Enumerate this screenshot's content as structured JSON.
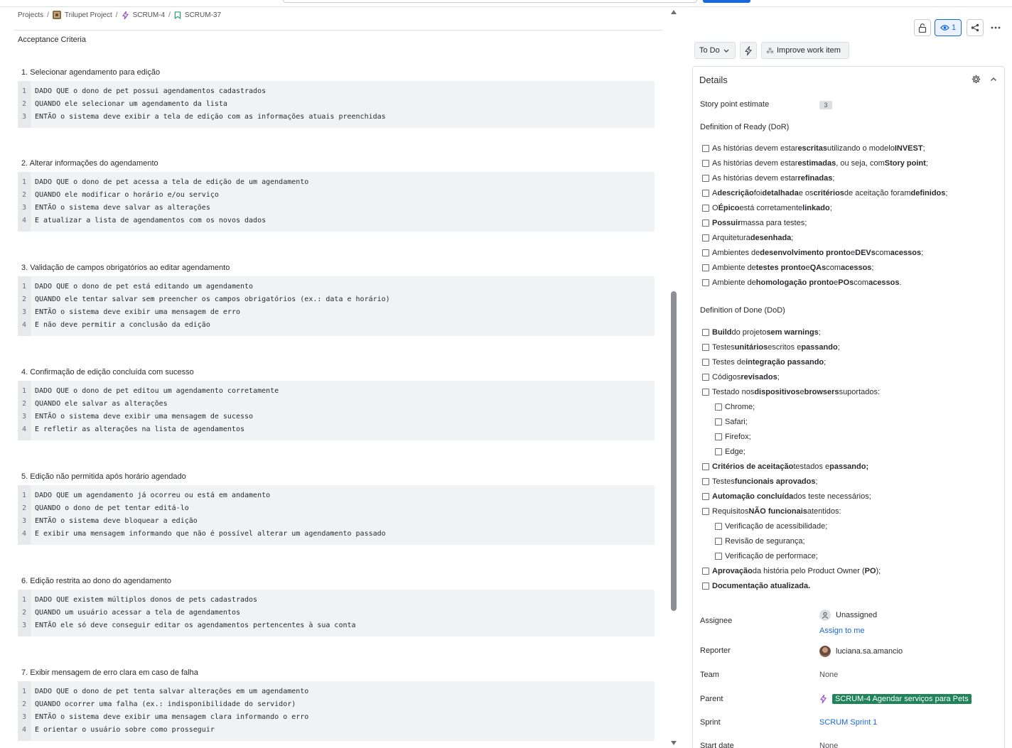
{
  "breadcrumb": {
    "items": [
      "Projects",
      "Trilupet Project",
      "SCRUM-4",
      "SCRUM-37"
    ],
    "separator": "/"
  },
  "main": {
    "section_title": "Acceptance Criteria",
    "criteria": [
      {
        "title": "1. Selecionar agendamento para edição",
        "lines": [
          "DADO QUE o dono de pet possui agendamentos cadastrados",
          "QUANDO ele selecionar um agendamento da lista",
          "ENTÃO o sistema deve exibir a tela de edição com as informações atuais preenchidas"
        ]
      },
      {
        "title": "2. Alterar informações do agendamento",
        "lines": [
          "DADO QUE o dono de pet acessa a tela de edição de um agendamento",
          "QUANDO ele modificar o horário e/ou serviço",
          "ENTÃO o sistema deve salvar as alterações",
          "E atualizar a lista de agendamentos com os novos dados"
        ]
      },
      {
        "title": "3. Validação de campos obrigatórios ao editar agendamento",
        "lines": [
          "DADO QUE o dono de pet está editando um agendamento",
          "QUANDO ele tentar salvar sem preencher os campos obrigatórios (ex.: data e horário)",
          "ENTÃO o sistema deve exibir uma mensagem de erro",
          "E não deve permitir a conclusão da edição"
        ]
      },
      {
        "title": "4. Confirmação de edição concluída com sucesso",
        "lines": [
          "DADO QUE o dono de pet editou um agendamento corretamente",
          "QUANDO ele salvar as alterações",
          "ENTÃO o sistema deve exibir uma mensagem de sucesso",
          "E refletir as alterações na lista de agendamentos"
        ]
      },
      {
        "title": "5. Edição não permitida após horário agendado",
        "lines": [
          "DADO QUE um agendamento já ocorreu ou está em andamento",
          "QUANDO o dono de pet tentar editá-lo",
          "ENTÃO o sistema deve bloquear a edição",
          "E exibir uma mensagem informando que não é possível alterar um agendamento passado"
        ]
      },
      {
        "title": "6. Edição restrita ao dono do agendamento",
        "lines": [
          "DADO QUE existem múltiplos donos de pets cadastrados",
          "QUANDO um usuário acessar a tela de agendamentos",
          "ENTÃO ele só deve conseguir editar os agendamentos pertencentes à sua conta"
        ]
      },
      {
        "title": "7. Exibir mensagem de erro clara em caso de falha",
        "lines": [
          "DADO QUE o dono de pet tenta salvar alterações em um agendamento",
          "QUANDO ocorrer uma falha (ex.: indisponibilidade do servidor)",
          "ENTÃO o sistema deve exibir uma mensagem clara informando o erro",
          "E orientar o usuário sobre como prosseguir"
        ]
      }
    ]
  },
  "toolbar": {
    "watch_count": "1",
    "status_label": "To Do",
    "improve_label": "Improve work item"
  },
  "details": {
    "header": "Details",
    "story_point_label": "Story point estimate",
    "story_point_value": "3",
    "dor_label": "Definition of Ready (DoR)",
    "dor_items": [
      [
        [
          "As histórias devem estar ",
          false
        ],
        [
          "escritas",
          true
        ],
        [
          " utilizando o modelo ",
          false
        ],
        [
          "INVEST",
          true
        ],
        [
          ";",
          false
        ]
      ],
      [
        [
          "As histórias devem estar ",
          false
        ],
        [
          "estimadas",
          true
        ],
        [
          ", ou seja, com ",
          false
        ],
        [
          "Story point",
          true
        ],
        [
          ";",
          false
        ]
      ],
      [
        [
          "As histórias devem estar ",
          false
        ],
        [
          "refinadas",
          true
        ],
        [
          ";",
          false
        ]
      ],
      [
        [
          "A ",
          false
        ],
        [
          "descrição",
          true
        ],
        [
          " foi ",
          false
        ],
        [
          "detalhada",
          true
        ],
        [
          " e os ",
          false
        ],
        [
          "critérios",
          true
        ],
        [
          " de aceitação foram ",
          false
        ],
        [
          "definidos",
          true
        ],
        [
          ";",
          false
        ]
      ],
      [
        [
          "O ",
          false
        ],
        [
          "Épico",
          true
        ],
        [
          " está corretamente ",
          false
        ],
        [
          "linkado",
          true
        ],
        [
          ";",
          false
        ]
      ],
      [
        [
          "Possuir",
          true
        ],
        [
          " massa para testes;",
          false
        ]
      ],
      [
        [
          "Arquitetura ",
          false
        ],
        [
          "desenhada",
          true
        ],
        [
          ";",
          false
        ]
      ],
      [
        [
          "Ambientes de ",
          false
        ],
        [
          "desenvolvimento pronto",
          true
        ],
        [
          " e ",
          false
        ],
        [
          "DEVs",
          true
        ],
        [
          " com ",
          false
        ],
        [
          "acessos",
          true
        ],
        [
          ";",
          false
        ]
      ],
      [
        [
          "Ambiente de ",
          false
        ],
        [
          "testes pronto",
          true
        ],
        [
          " e ",
          false
        ],
        [
          "QAs",
          true
        ],
        [
          " com ",
          false
        ],
        [
          "acessos",
          true
        ],
        [
          ";",
          false
        ]
      ],
      [
        [
          "Ambiente de ",
          false
        ],
        [
          "homologação pronto",
          true
        ],
        [
          " e ",
          false
        ],
        [
          "POs",
          true
        ],
        [
          " com ",
          false
        ],
        [
          "acessos",
          true
        ],
        [
          ".",
          false
        ]
      ]
    ],
    "dod_label": "Definition of Done (DoD)",
    "dod_items": [
      {
        "indent": 0,
        "parts": [
          [
            "Build",
            true
          ],
          [
            " do projeto ",
            false
          ],
          [
            "sem warnings",
            true
          ],
          [
            ";",
            false
          ]
        ]
      },
      {
        "indent": 0,
        "parts": [
          [
            "Testes ",
            false
          ],
          [
            "unitários",
            true
          ],
          [
            " escritos e ",
            false
          ],
          [
            "passando",
            true
          ],
          [
            ";",
            false
          ]
        ]
      },
      {
        "indent": 0,
        "parts": [
          [
            "Testes de ",
            false
          ],
          [
            "integração passando",
            true
          ],
          [
            ";",
            false
          ]
        ]
      },
      {
        "indent": 0,
        "parts": [
          [
            "Códigos ",
            false
          ],
          [
            "revisados",
            true
          ],
          [
            ";",
            false
          ]
        ]
      },
      {
        "indent": 0,
        "parts": [
          [
            "Testado nos ",
            false
          ],
          [
            "dispositivos",
            true
          ],
          [
            " e ",
            false
          ],
          [
            "browsers",
            true
          ],
          [
            " suportados:",
            false
          ]
        ]
      },
      {
        "indent": 1,
        "parts": [
          [
            "Chrome;",
            false
          ]
        ]
      },
      {
        "indent": 1,
        "parts": [
          [
            "Safari;",
            false
          ]
        ]
      },
      {
        "indent": 1,
        "parts": [
          [
            "Firefox;",
            false
          ]
        ]
      },
      {
        "indent": 1,
        "parts": [
          [
            "Edge;",
            false
          ]
        ]
      },
      {
        "indent": 0,
        "parts": [
          [
            "Critérios de aceitação",
            true
          ],
          [
            " testados e ",
            false
          ],
          [
            "passando;",
            true
          ]
        ]
      },
      {
        "indent": 0,
        "parts": [
          [
            "Testes ",
            false
          ],
          [
            "funcionais aprovados",
            true
          ],
          [
            ";",
            false
          ]
        ]
      },
      {
        "indent": 0,
        "parts": [
          [
            "Automação concluída",
            true
          ],
          [
            " dos teste necessários;",
            false
          ]
        ]
      },
      {
        "indent": 0,
        "parts": [
          [
            "Requisitos ",
            false
          ],
          [
            "NÃO funcionais",
            true
          ],
          [
            " atentidos:",
            false
          ]
        ]
      },
      {
        "indent": 1,
        "parts": [
          [
            "Verificação de acessibilidade;",
            false
          ]
        ]
      },
      {
        "indent": 1,
        "parts": [
          [
            "Revisão de segurança;",
            false
          ]
        ]
      },
      {
        "indent": 1,
        "parts": [
          [
            "Verificação de performace;",
            false
          ]
        ]
      },
      {
        "indent": 0,
        "parts": [
          [
            "Aprovação",
            true
          ],
          [
            " da história pelo Product Owner (",
            false
          ],
          [
            "PO",
            true
          ],
          [
            ");",
            false
          ]
        ]
      },
      {
        "indent": 0,
        "parts": [
          [
            "Documentação atualizada.",
            true
          ]
        ]
      }
    ],
    "assignee_label": "Assignee",
    "assignee_value": "Unassigned",
    "assign_to_me": "Assign to me",
    "reporter_label": "Reporter",
    "reporter_value": "luciana.sa.amancio",
    "team_label": "Team",
    "team_value": "None",
    "parent_label": "Parent",
    "parent_value": "SCRUM-4 Agendar serviços para Pets",
    "sprint_label": "Sprint",
    "sprint_value": "SCRUM Sprint 1",
    "start_date_label": "Start date",
    "start_date_value": "None"
  },
  "colors": {
    "accent": "#1868db",
    "parent_chip": "#1f845a",
    "code_bg": "#f1f2f4",
    "epic_icon": "#964ac0",
    "story_icon": "#22a06b"
  },
  "icons": [
    "lock-icon",
    "eye-icon",
    "share-icon",
    "more-icon",
    "lightning-icon",
    "sparkle-icon",
    "gear-icon",
    "chevron-up-icon",
    "chevron-down-icon",
    "person-icon"
  ]
}
